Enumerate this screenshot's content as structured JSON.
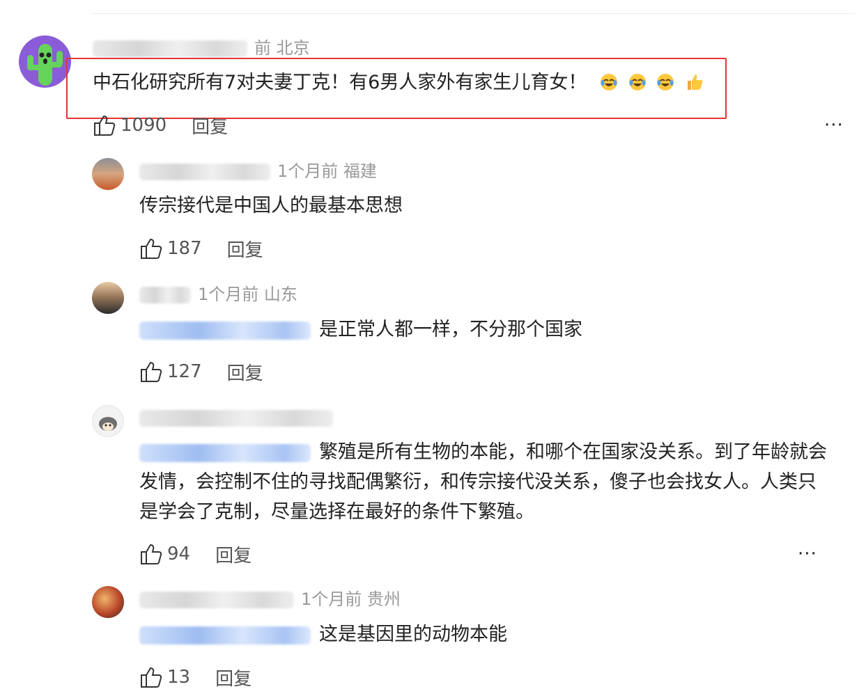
{
  "comments": [
    {
      "meta": "前 北京",
      "text": "中石化研究所有7对夫妻丁克！有6男人家外有家生儿育女！",
      "emoji": [
        "crying-laughing-emoji",
        "crying-laughing-emoji",
        "crying-laughing-emoji",
        "thumbs-up-emoji"
      ],
      "likes": "1090",
      "reply_label": "回复",
      "more": "···"
    },
    {
      "meta": "1个月前 福建",
      "text": "传宗接代是中国人的最基本思想",
      "likes": "187",
      "reply_label": "回复"
    },
    {
      "meta": "1个月前 山东",
      "text": "是正常人都一样，不分那个国家",
      "likes": "127",
      "reply_label": "回复"
    },
    {
      "text": "繁殖是所有生物的本能，和哪个在国家没关系。到了年龄就会发情，会控制不住的寻找配偶繁衍，和传宗接代没关系，傻子也会找女人。人类只是学会了克制，尽量选择在最好的条件下繁殖。",
      "likes": "94",
      "reply_label": "回复",
      "more": "···"
    },
    {
      "meta": "1个月前 贵州",
      "text": "这是基因里的动物本能",
      "likes": "13",
      "reply_label": "回复"
    }
  ],
  "colors": {
    "highlight": "#e43434",
    "meta": "#999999",
    "mention": "#4a7fd9",
    "text": "#222222"
  }
}
